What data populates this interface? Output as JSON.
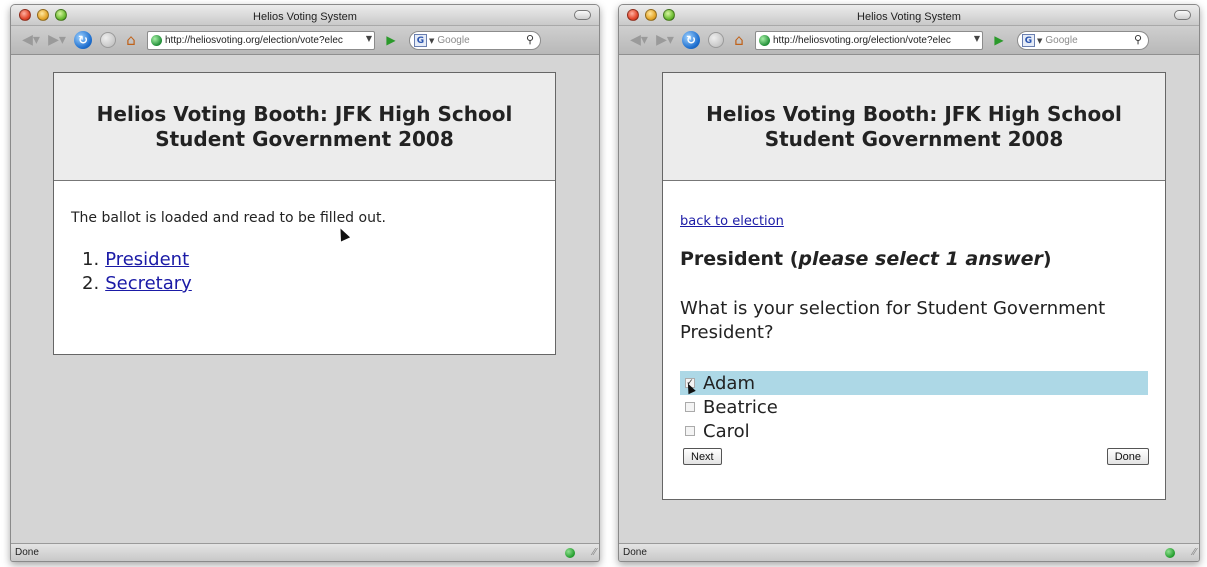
{
  "left_window": {
    "title": "Helios Voting System",
    "url": "http://heliosvoting.org/election/vote?elec",
    "search_placeholder": "Google",
    "status": "Done",
    "booth_title": "Helios Voting Booth: JFK High School Student Government 2008",
    "message": "The ballot is loaded and read to be filled out.",
    "questions": [
      {
        "num": "1.",
        "label": "President"
      },
      {
        "num": "2.",
        "label": "Secretary"
      }
    ]
  },
  "right_window": {
    "title": "Helios Voting System",
    "url": "http://heliosvoting.org/election/vote?elec",
    "search_placeholder": "Google",
    "status": "Done",
    "booth_title": "Helios Voting Booth: JFK High School Student Government 2008",
    "back_link": "back to election",
    "question_name": "President (",
    "question_hint": "please select 1 answer",
    "question_close": ")",
    "question_text": "What is your selection for Student Government President?",
    "answers": [
      {
        "label": "Adam",
        "selected": true
      },
      {
        "label": "Beatrice",
        "selected": false
      },
      {
        "label": "Carol",
        "selected": false
      }
    ],
    "next_label": "Next",
    "done_label": "Done"
  },
  "colors": {
    "selected_answer": "#add8e6",
    "link": "#1a1aa6",
    "header_bg": "#ececec",
    "page_bg": "#d5d5d5"
  },
  "icons": {
    "back": "back-arrow-icon",
    "forward": "forward-arrow-icon",
    "reload": "reload-icon",
    "stop": "stop-icon",
    "home": "home-icon",
    "go": "go-arrow-icon",
    "search": "magnifier-icon",
    "secure": "status-ok-icon"
  }
}
